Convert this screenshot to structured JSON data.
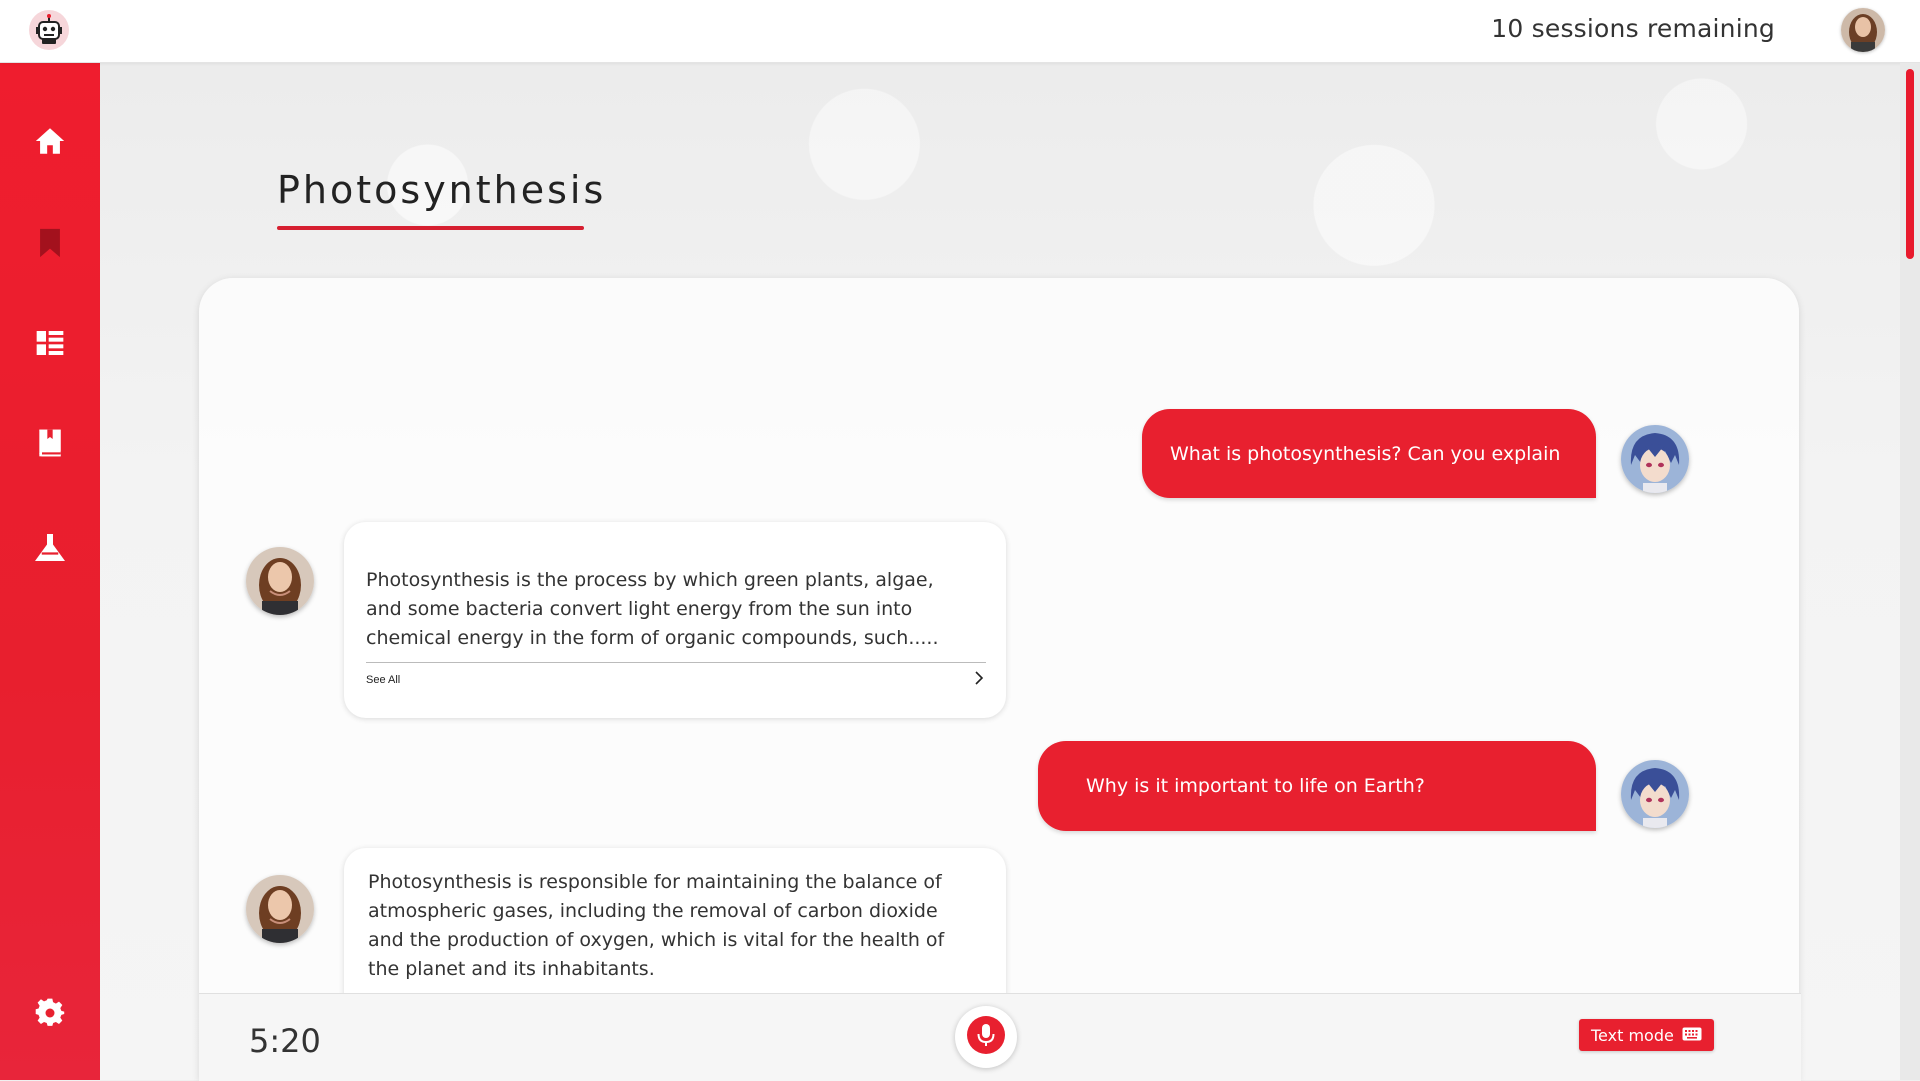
{
  "header": {
    "sessions_text": "10 sessions remaining",
    "logo_icon": "robot-icon",
    "profile_icon": "user-avatar"
  },
  "sidebar": {
    "items": [
      {
        "name": "home",
        "icon": "home-icon"
      },
      {
        "name": "bookmarks",
        "icon": "bookmark-icon"
      },
      {
        "name": "dashboard",
        "icon": "dashboard-icon"
      },
      {
        "name": "library",
        "icon": "book-icon"
      },
      {
        "name": "lab",
        "icon": "flask-icon"
      }
    ],
    "settings_icon": "gear-icon"
  },
  "page": {
    "title": "Photosynthesis"
  },
  "chat": {
    "messages": [
      {
        "role": "user",
        "text": "What is photosynthesis? Can you explain"
      },
      {
        "role": "bot",
        "text": "Photosynthesis is the process by which green plants, algae, and some bacteria convert light energy from the sun into chemical energy in the form of organic compounds, such.....",
        "see_all": "See All"
      },
      {
        "role": "user",
        "text": "Why is it important to life on Earth?"
      },
      {
        "role": "bot",
        "text": "Photosynthesis is responsible for maintaining the balance of atmospheric gases, including the removal of carbon dioxide and the production of oxygen, which is vital for the health of the planet and its inhabitants."
      }
    ]
  },
  "footer": {
    "timer": "5:20",
    "text_mode_label": "Text mode",
    "mic_icon": "microphone-icon",
    "keyboard_icon": "keyboard-icon"
  },
  "colors": {
    "accent": "#e8202f",
    "sidebar": "#ef1d2e"
  }
}
